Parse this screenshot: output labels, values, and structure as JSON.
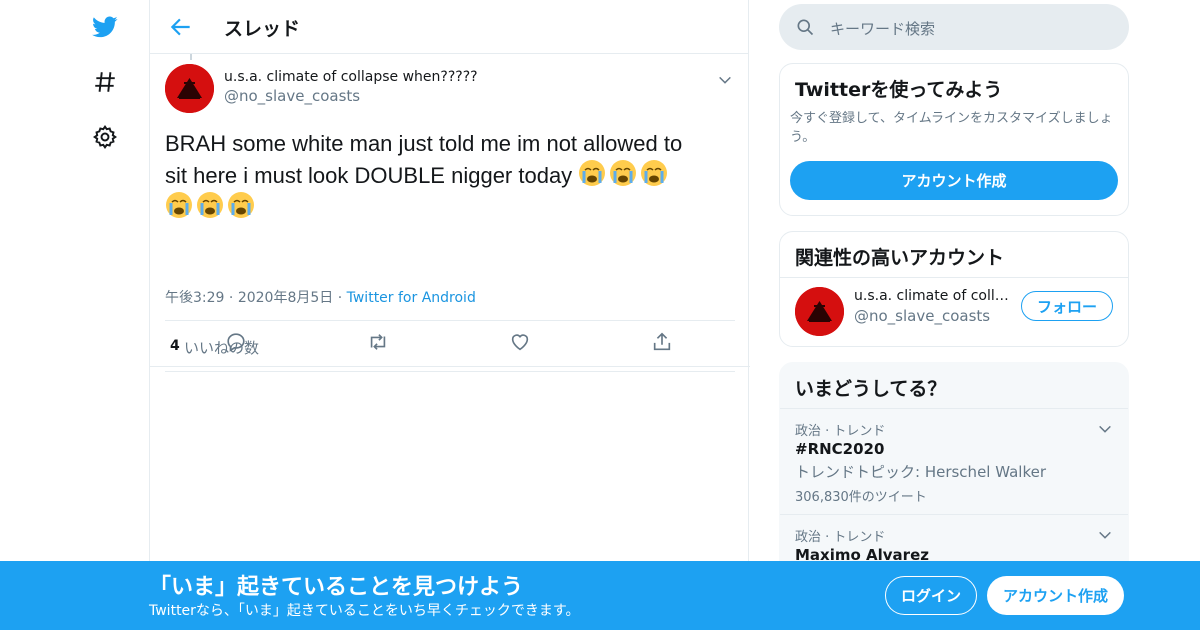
{
  "colors": {
    "accent": "#1da1f2",
    "text": "#14171a",
    "muted": "#657786",
    "border": "#e6ecf0",
    "avatar": "#d50f0f"
  },
  "leftnav": {
    "icons": [
      "twitter-bird-icon",
      "hashtag-icon",
      "gear-icon"
    ]
  },
  "header": {
    "title": "スレッド"
  },
  "tweet": {
    "user_name": "u.s.a. climate of collapse when?????",
    "user_handle": "@no_slave_coasts",
    "text_line1": "BRAH some white man just told me im not allowed to",
    "text_line2": "sit here i must look DOUBLE nigger today",
    "emoji_count": 6,
    "time": "午後3:29",
    "date": "2020年8月5日",
    "source": "Twitter for Android",
    "like_count": "4",
    "like_label": "いいねの数"
  },
  "search": {
    "placeholder": "キーワード検索"
  },
  "signup_card": {
    "title": "Twitterを使ってみよう",
    "description": "今すぐ登録して、タイムラインをカスタマイズしましょう。",
    "button": "アカウント作成"
  },
  "related": {
    "title": "関連性の高いアカウント",
    "name": "u.s.a. climate of colla...",
    "handle": "@no_slave_coasts",
    "follow": "フォロー"
  },
  "trends": {
    "title": "いまどうしてる？",
    "items": [
      {
        "category": "政治 · トレンド",
        "name": "#RNC2020",
        "topic": "トレンドトピック: Herschel Walker",
        "count": "306,830件のツイート"
      },
      {
        "category": "政治 · トレンド",
        "name": "Maximo Alvarez"
      }
    ]
  },
  "bottom_bar": {
    "title": "「いま」起きていることを見つけよう",
    "subtitle": "Twitterなら、「いま」起きていることをいち早くチェックできます。",
    "login": "ログイン",
    "signup": "アカウント作成"
  }
}
